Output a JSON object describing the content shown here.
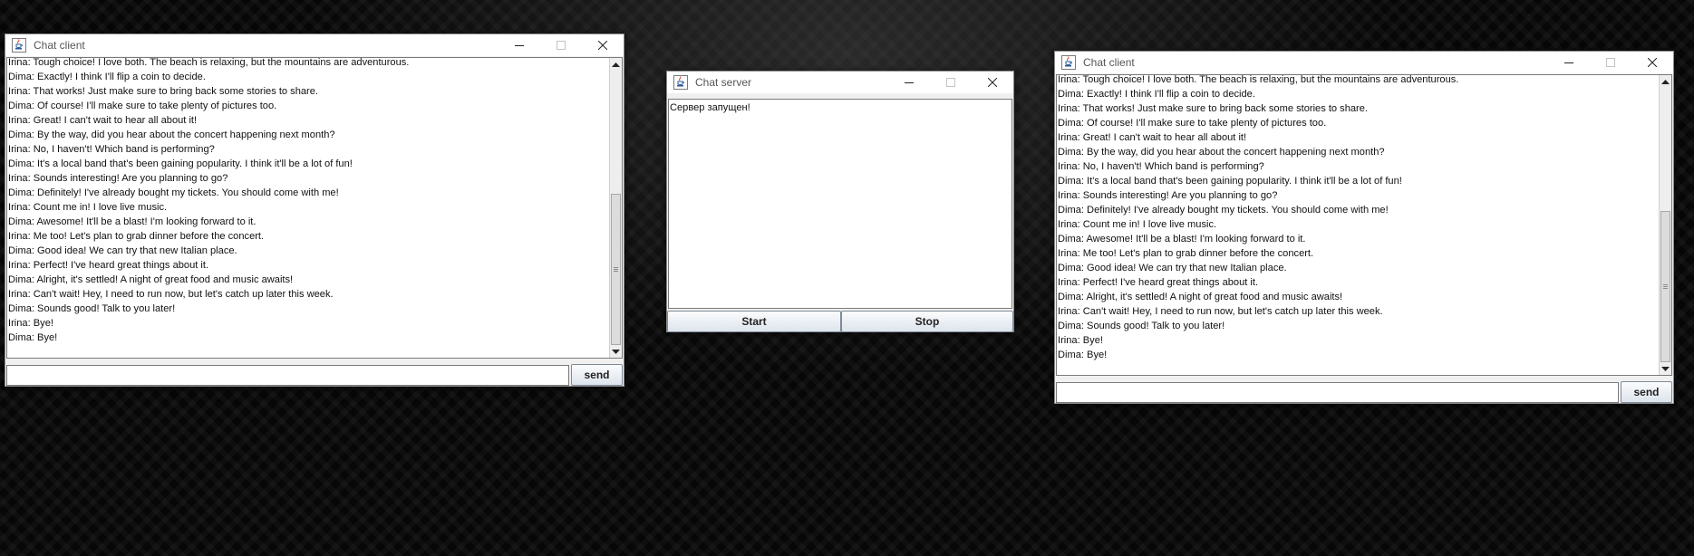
{
  "client_left": {
    "title": "Chat client",
    "messages": [
      "Irina: Tough choice! I love both. The beach is relaxing, but the mountains are adventurous.",
      "Dima: Exactly! I think I'll flip a coin to decide.",
      "Irina: That works! Just make sure to bring back some stories to share.",
      "Dima: Of course! I'll make sure to take plenty of pictures too.",
      "Irina: Great! I can't wait to hear all about it!",
      "Dima: By the way, did you hear about the concert happening next month?",
      "Irina: No, I haven't! Which band is performing?",
      "Dima: It's a local band that's been gaining popularity. I think it'll be a lot of fun!",
      "Irina: Sounds interesting! Are you planning to go?",
      "Dima: Definitely! I've already bought my tickets. You should come with me!",
      "Irina: Count me in! I love live music.",
      "Dima: Awesome! It'll be a blast! I'm looking forward to it.",
      "Irina: Me too! Let's plan to grab dinner before the concert.",
      "Dima: Good idea! We can try that new Italian place.",
      "Irina: Perfect! I've heard great things about it.",
      "Dima: Alright, it's settled! A night of great food and music awaits!",
      "Irina: Can't wait! Hey, I need to run now, but let's catch up later this week.",
      "Dima: Sounds good! Talk to you later!",
      "Irina: Bye!",
      "Dima: Bye!"
    ],
    "input_value": "",
    "send_label": "send"
  },
  "server": {
    "title": "Chat server",
    "log": "Сервер запущен!",
    "start_label": "Start",
    "stop_label": "Stop"
  },
  "client_right": {
    "title": "Chat client",
    "messages": [
      "Irina: Tough choice! I love both. The beach is relaxing, but the mountains are adventurous.",
      "Dima: Exactly! I think I'll flip a coin to decide.",
      "Irina: That works! Just make sure to bring back some stories to share.",
      "Dima: Of course! I'll make sure to take plenty of pictures too.",
      "Irina: Great! I can't wait to hear all about it!",
      "Dima: By the way, did you hear about the concert happening next month?",
      "Irina: No, I haven't! Which band is performing?",
      "Dima: It's a local band that's been gaining popularity. I think it'll be a lot of fun!",
      "Irina: Sounds interesting! Are you planning to go?",
      "Dima: Definitely! I've already bought my tickets. You should come with me!",
      "Irina: Count me in! I love live music.",
      "Dima: Awesome! It'll be a blast! I'm looking forward to it.",
      "Irina: Me too! Let's plan to grab dinner before the concert.",
      "Dima: Good idea! We can try that new Italian place.",
      "Irina: Perfect! I've heard great things about it.",
      "Dima: Alright, it's settled! A night of great food and music awaits!",
      "Irina: Can't wait! Hey, I need to run now, but let's catch up later this week.",
      "Dima: Sounds good! Talk to you later!",
      "Irina: Bye!",
      "Dima: Bye!"
    ],
    "input_value": "",
    "send_label": "send"
  },
  "icons": {
    "app": "java-icon",
    "minimize": "minimize-icon",
    "maximize": "maximize-icon",
    "close": "close-icon"
  }
}
